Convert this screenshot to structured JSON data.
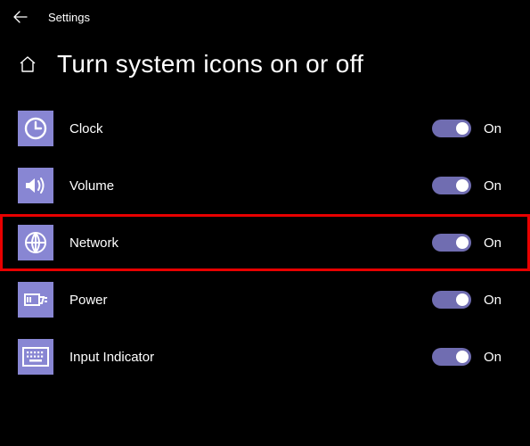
{
  "app_title": "Settings",
  "page_title": "Turn system icons on or off",
  "toggle_on_label": "On",
  "colors": {
    "icon_bg": "#8886d3",
    "toggle_bg": "#706db1",
    "highlight_border": "#e80000"
  },
  "items": [
    {
      "id": "clock",
      "label": "Clock",
      "icon": "clock-icon",
      "state": "On",
      "highlighted": false
    },
    {
      "id": "volume",
      "label": "Volume",
      "icon": "volume-icon",
      "state": "On",
      "highlighted": false
    },
    {
      "id": "network",
      "label": "Network",
      "icon": "globe-icon",
      "state": "On",
      "highlighted": true
    },
    {
      "id": "power",
      "label": "Power",
      "icon": "power-icon",
      "state": "On",
      "highlighted": false
    },
    {
      "id": "input",
      "label": "Input Indicator",
      "icon": "keyboard-icon",
      "state": "On",
      "highlighted": false
    }
  ]
}
